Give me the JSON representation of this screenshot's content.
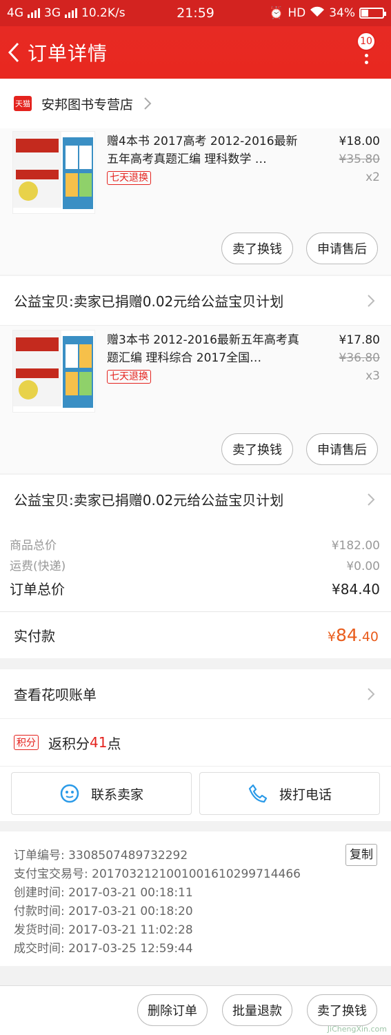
{
  "status_bar": {
    "net1": "4G",
    "net2": "3G",
    "speed": "10.2K/s",
    "time": "21:59",
    "hd": "HD",
    "battery_text": "34%",
    "battery_level": 0.34
  },
  "nav": {
    "title": "订单详情",
    "badge": "10"
  },
  "shop": {
    "tag": "天猫",
    "name": "安邦图书专营店"
  },
  "items": [
    {
      "title": "赠4本书 2017高考 2012-2016最新五年高考真题汇编 理科数学 …",
      "tag": "七天退换",
      "price": "¥18.00",
      "old_price": "¥35.80",
      "qty": "x2",
      "btn_sell": "卖了换钱",
      "btn_after": "申请售后",
      "charity": "公益宝贝:卖家已捐赠0.02元给公益宝贝计划"
    },
    {
      "title": "赠3本书 2012-2016最新五年高考真题汇编 理科综合 2017全国…",
      "tag": "七天退换",
      "price": "¥17.80",
      "old_price": "¥36.80",
      "qty": "x3",
      "btn_sell": "卖了换钱",
      "btn_after": "申请售后",
      "charity": "公益宝贝:卖家已捐赠0.02元给公益宝贝计划"
    }
  ],
  "summary": {
    "goods_label": "商品总价",
    "goods_value": "¥182.00",
    "ship_label": "运费(快递)",
    "ship_value": "¥0.00",
    "total_label": "订单总价",
    "total_value": "¥84.40",
    "paid_label": "实付款",
    "paid_currency": "¥",
    "paid_int": "84",
    "paid_dec": ".40"
  },
  "huabei": "查看花呗账单",
  "points": {
    "tag": "积分",
    "prefix": "返积分",
    "num": "41",
    "suffix": "点"
  },
  "contact": {
    "seller": "联系卖家",
    "phone": "拨打电话"
  },
  "order_info": {
    "order_no": "订单编号: 3308507489732292",
    "alipay_no": "支付宝交易号: 2017032121001001610299714466",
    "created": "创建时间: 2017-03-21 00:18:11",
    "paid": "付款时间: 2017-03-21 00:18:20",
    "shipped": "发货时间: 2017-03-21 11:02:28",
    "done": "成交时间: 2017-03-25 12:59:44",
    "copy": "复制"
  },
  "bottom": {
    "delete": "删除订单",
    "refund": "批量退款",
    "sell": "卖了换钱"
  },
  "watermark": "JiChengXin.com"
}
